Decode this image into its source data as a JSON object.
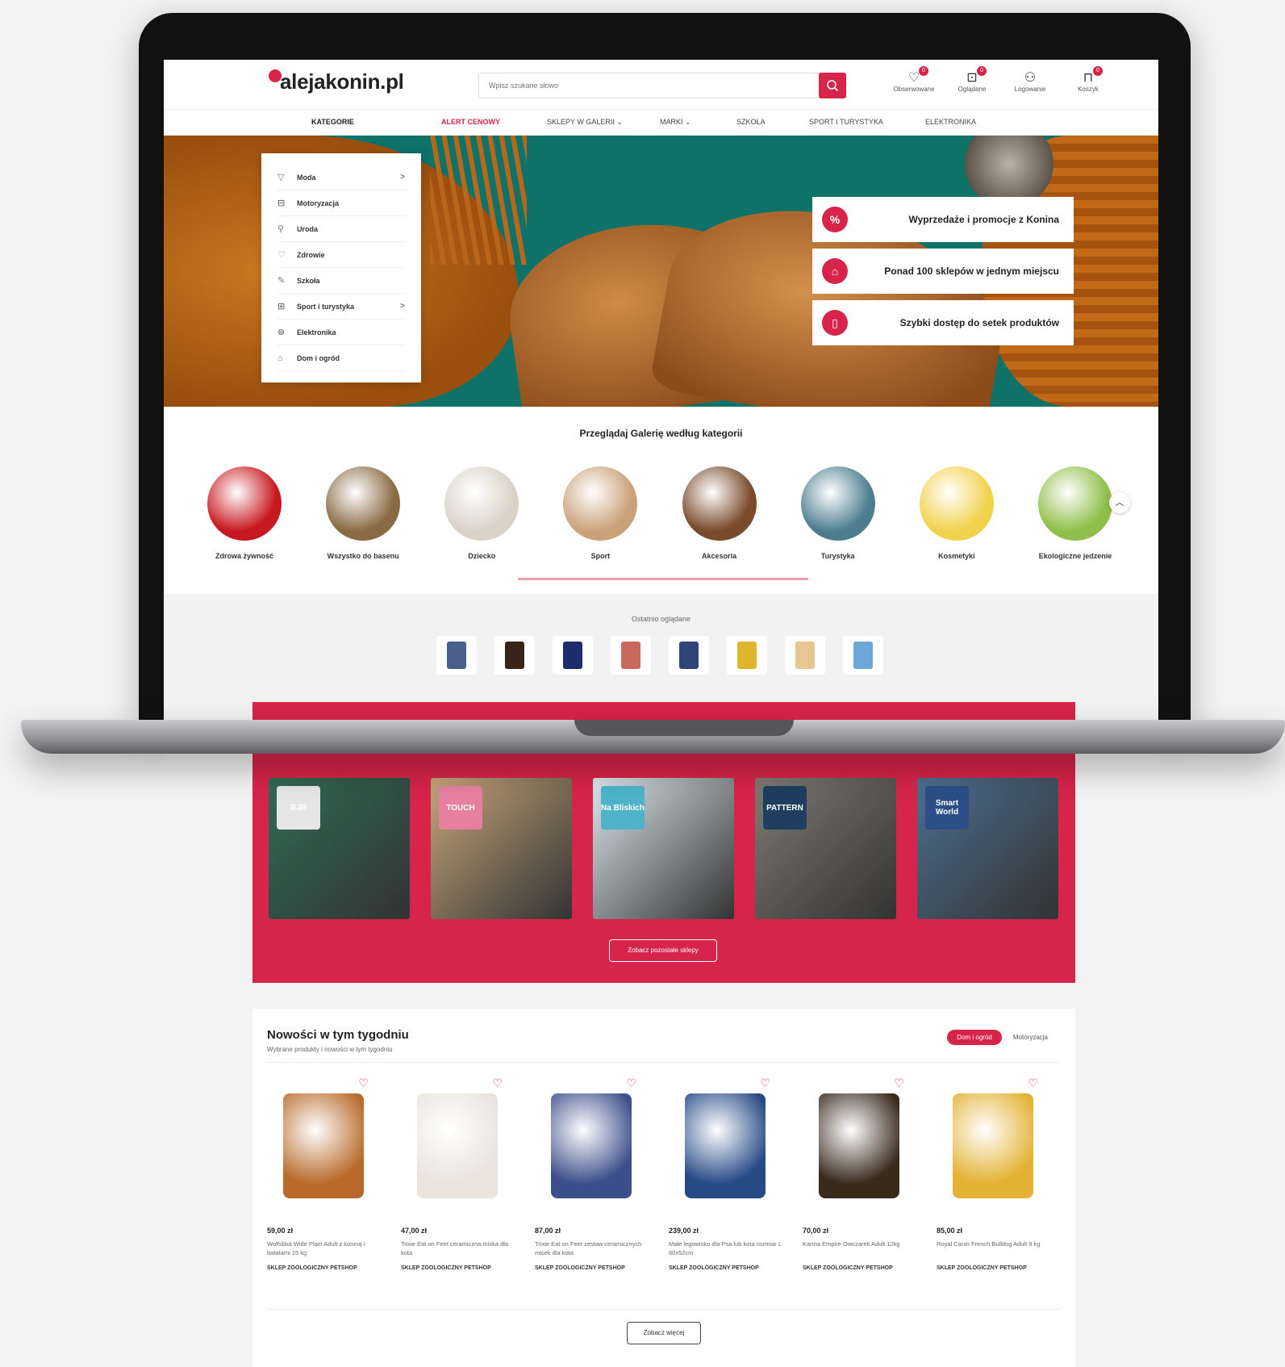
{
  "header": {
    "logo": "alejakonin.pl",
    "search_placeholder": "Wpisz szukane słowo",
    "icons": [
      {
        "label": "Obserwowane",
        "icon": "heart-icon",
        "badge": "0"
      },
      {
        "label": "Oglądane",
        "icon": "eye-icon",
        "badge": "0"
      },
      {
        "label": "Logowanie",
        "icon": "user-icon",
        "badge": ""
      },
      {
        "label": "Koszyk",
        "icon": "bag-icon",
        "badge": "0"
      }
    ]
  },
  "nav": {
    "categories": "KATEGORIE",
    "alert": "ALERT CENOWY",
    "shops": "SKLEPY W GALERII ⌄",
    "brands": "MARKI ⌄",
    "school": "SZKOŁA",
    "sport": "SPORT I TURYSTYKA",
    "electronics": "ELEKTRONIKA"
  },
  "category_menu": [
    {
      "label": "Moda",
      "icon": "shirt-icon",
      "arrow": ">"
    },
    {
      "label": "Motoryzacja",
      "icon": "car-icon",
      "arrow": ""
    },
    {
      "label": "Uroda",
      "icon": "cosmetics-icon",
      "arrow": ""
    },
    {
      "label": "Zdrowie",
      "icon": "heart-health-icon",
      "arrow": ""
    },
    {
      "label": "Szkoła",
      "icon": "school-icon",
      "arrow": ""
    },
    {
      "label": "Sport i turystyka",
      "icon": "sport-icon",
      "arrow": ">"
    },
    {
      "label": "Elektronika",
      "icon": "electronics-icon",
      "arrow": ""
    },
    {
      "label": "Dom i ogród",
      "icon": "home-icon",
      "arrow": ""
    }
  ],
  "promos": [
    {
      "text": "Wyprzedaże i promocje z Konina",
      "icon": "percent-icon"
    },
    {
      "text": "Ponad 100 sklepów w jednym miejscu",
      "icon": "shop-icon"
    },
    {
      "text": "Szybki dostęp do setek produktów",
      "icon": "phone-icon"
    }
  ],
  "categories_section": {
    "title": "Przeglądaj Galerię według kategorii",
    "items": [
      {
        "label": "Zdrowa żywność",
        "color": "#c8181f"
      },
      {
        "label": "Wszystko do basenu",
        "color": "#8a6a44"
      },
      {
        "label": "Dziecko",
        "color": "#d9d2c7"
      },
      {
        "label": "Sport",
        "color": "#caa27a"
      },
      {
        "label": "Akcesoria",
        "color": "#7a4a2c"
      },
      {
        "label": "Turystyka",
        "color": "#4d7e8f"
      },
      {
        "label": "Kosmetyki",
        "color": "#f1d24c"
      },
      {
        "label": "Ekologiczne jedzenie",
        "color": "#8fbf4a"
      }
    ]
  },
  "recent": {
    "title": "Ostatnio oglądane",
    "thumbs": [
      "#4a5f8c",
      "#3a2418",
      "#1d2c6b",
      "#c9685d",
      "#2f4577",
      "#e0b52c",
      "#e8c68f",
      "#6da7d8"
    ]
  },
  "shops": {
    "items": [
      {
        "logo": "RJR",
        "bg": "#2f6b55",
        "logo_bg": "#e6e6e6"
      },
      {
        "logo": "TOUCH",
        "bg": "#c5a57a",
        "logo_bg": "#e77fa0"
      },
      {
        "logo": "Na Bliskich",
        "bg": "#dde6ea",
        "logo_bg": "#4fb3c9"
      },
      {
        "logo": "PATTERN",
        "bg": "#7f7a73",
        "logo_bg": "#1f3e60"
      },
      {
        "logo": "Smart World",
        "bg": "#4c6f8f",
        "logo_bg": "#2b4f86"
      }
    ],
    "button": "Zobacz pozostałe sklepy"
  },
  "news": {
    "title": "Nowości w tym tygodniu",
    "subtitle": "Wybrane produkty i nowości w tym tygodniu",
    "tab_active": "Dom i ogród",
    "tab_other": "Motoryzacja",
    "products": [
      {
        "price": "59,00 zł",
        "name": "Wolfsblut Wide Plain Adult z koniną i batatami 15 kg",
        "shop": "SKLEP ZOOLOGICZNY PETSHOP",
        "color": "#b86a2a"
      },
      {
        "price": "47,00 zł",
        "name": "Trixie Eat on Feet ceramiczna miska dla kota",
        "shop": "SKLEP ZOOLOGICZNY PETSHOP",
        "color": "#e9e4dc"
      },
      {
        "price": "87,00 zł",
        "name": "Trixie Eat on Feet zestaw ceramicznych misek dla kota",
        "shop": "SKLEP ZOOLOGICZNY PETSHOP",
        "color": "#3d4f8a"
      },
      {
        "price": "239,00 zł",
        "name": "Małe legowisko dla Psa lub kota rozmiar L 60x52cm",
        "shop": "SKLEP ZOOLOGICZNY PETSHOP",
        "color": "#274a86"
      },
      {
        "price": "70,00 zł",
        "name": "Karma Empire Owczarek Adult 12kg",
        "shop": "SKLEP ZOOLOGICZNY PETSHOP",
        "color": "#3a2a1c"
      },
      {
        "price": "85,00 zł",
        "name": "Royal Canin French Bulldog Adult 9 kg",
        "shop": "SKLEP ZOOLOGICZNY PETSHOP",
        "color": "#e3b233"
      }
    ],
    "more_button": "Zobacz więcej"
  },
  "colors": {
    "accent": "#d6244a"
  }
}
